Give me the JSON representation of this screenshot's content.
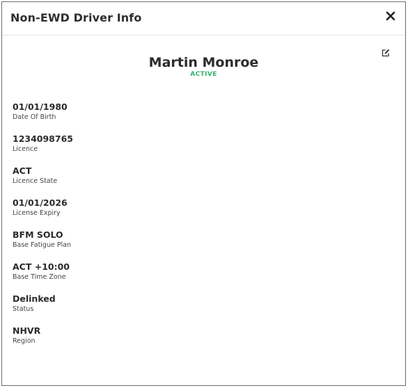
{
  "modal": {
    "title": "Non-EWD Driver Info"
  },
  "driver": {
    "name": "Martin Monroe",
    "status": "ACTIVE"
  },
  "fields": [
    {
      "value": "01/01/1980",
      "label": "Date Of Birth"
    },
    {
      "value": "1234098765",
      "label": "Licence"
    },
    {
      "value": "ACT",
      "label": "Licence State"
    },
    {
      "value": "01/01/2026",
      "label": "License Expiry"
    },
    {
      "value": "BFM SOLO",
      "label": "Base Fatigue Plan"
    },
    {
      "value": "ACT +10:00",
      "label": "Base Time Zone"
    },
    {
      "value": "Delinked",
      "label": "Status"
    },
    {
      "value": "NHVR",
      "label": "Region"
    }
  ],
  "icons": {
    "close": "close-icon",
    "edit": "edit-icon"
  },
  "colors": {
    "status_active": "#2fb36b",
    "border": "#6b6b6b",
    "divider": "#e2e2e2"
  }
}
